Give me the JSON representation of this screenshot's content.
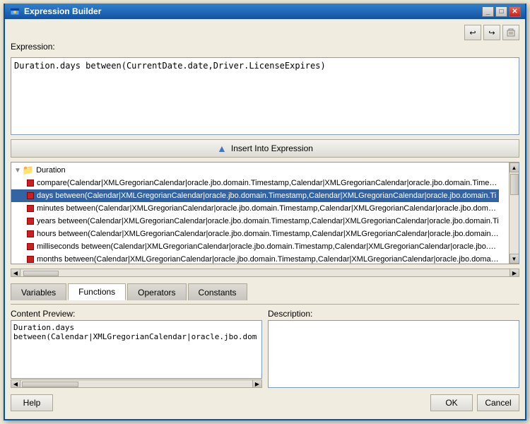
{
  "window": {
    "title": "Expression Builder",
    "icon": "builder-icon"
  },
  "toolbar": {
    "undo_label": "↩",
    "redo_label": "↪",
    "clear_label": "✕",
    "insert_btn_label": "Insert Into Expression"
  },
  "expression": {
    "label": "Expression:",
    "value": "Duration.days between(CurrentDate.date,Driver.LicenseExpires)"
  },
  "tree": {
    "root": "Duration",
    "items": [
      "compare(Calendar|XMLGregorianCalendar|oracle.jbo.domain.Timestamp,Calendar|XMLGregorianCalendar|oracle.jbo.domain.Timesta",
      "days between(Calendar|XMLGregorianCalendar|oracle.jbo.domain.Timestamp,Calendar|XMLGregorianCalendar|oracle.jbo.domain.Ti",
      "minutes between(Calendar|XMLGregorianCalendar|oracle.jbo.domain.Timestamp,Calendar|XMLGregorianCalendar|oracle.jbo.domain.",
      "years between(Calendar|XMLGregorianCalendar|oracle.jbo.domain.Timestamp,Calendar|XMLGregorianCalendar|oracle.jbo.domain.Ti",
      "hours between(Calendar|XMLGregorianCalendar|oracle.jbo.domain.Timestamp,Calendar|XMLGregorianCalendar|oracle.jbo.domain.Ti",
      "milliseconds between(Calendar|XMLGregorianCalendar|oracle.jbo.domain.Timestamp,Calendar|XMLGregorianCalendar|oracle.jbo.dom",
      "months between(Calendar|XMLGregorianCalendar|oracle.jbo.domain.Timestamp,Calendar|XMLGregorianCalendar|oracle.jbo.domain."
    ],
    "selected_index": 1
  },
  "tabs": [
    {
      "label": "Variables",
      "active": false
    },
    {
      "label": "Functions",
      "active": true
    },
    {
      "label": "Operators",
      "active": false
    },
    {
      "label": "Constants",
      "active": false
    }
  ],
  "content_preview": {
    "label": "Content Preview:",
    "value": "Duration.days between(Calendar|XMLGregorianCalendar|oracle.jbo.dom"
  },
  "description": {
    "label": "Description:",
    "value": ""
  },
  "footer": {
    "help_label": "Help",
    "ok_label": "OK",
    "cancel_label": "Cancel"
  }
}
